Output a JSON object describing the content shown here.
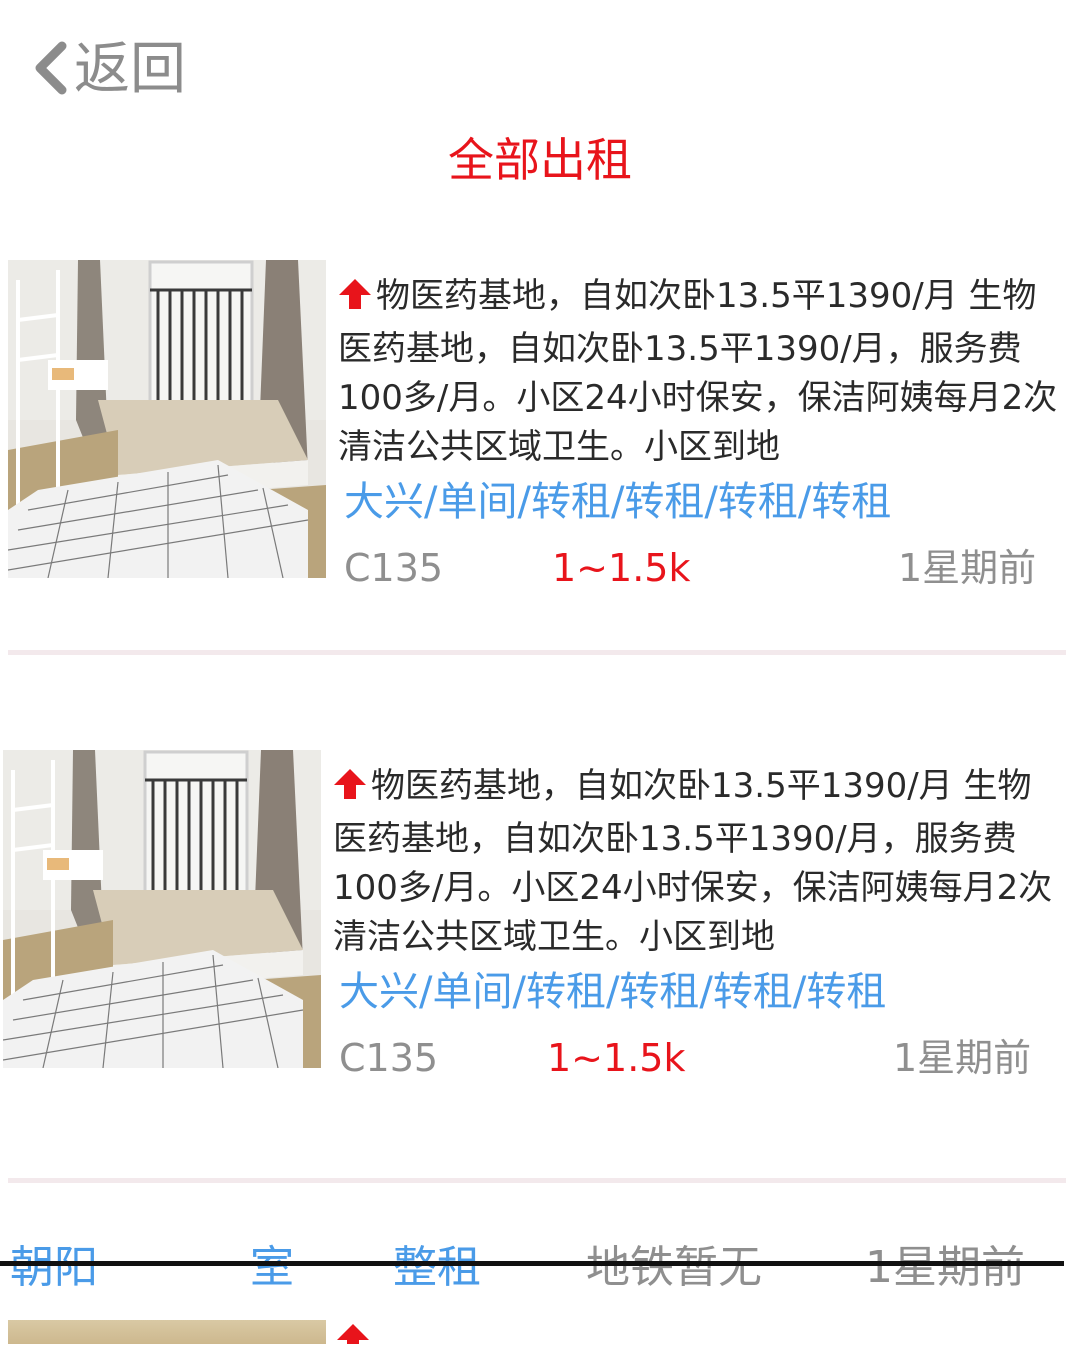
{
  "header": {
    "back_label": "返回"
  },
  "page_title": "全部出租",
  "listings": [
    {
      "description": "物医药基地，自如次卧13.5平1390/月 生物医药基地，自如次卧13.5平1390/月，服务费100多/月。小区24小时保安，保洁阿姨每月2次清洁公共区域卫生。小区到地",
      "tags": "大兴/单间/转租/转租/转租/转租",
      "code": "C135",
      "price": "1~1.5k",
      "time": "1星期前"
    },
    {
      "description": "物医药基地，自如次卧13.5平1390/月 生物医药基地，自如次卧13.5平1390/月，服务费100多/月。小区24小时保安，保洁阿姨每月2次清洁公共区域卫生。小区到地",
      "tags": "大兴/单间/转租/转租/转租/转租",
      "code": "C135",
      "price": "1~1.5k",
      "time": "1星期前"
    }
  ],
  "bottom_row": {
    "district": "朝阳",
    "room": "室",
    "rent_type": "整租",
    "subway": "地铁暂无",
    "time": "1星期前"
  },
  "colors": {
    "accent_red": "#e8141b",
    "tag_blue": "#4a9be8",
    "meta_gray": "#8f8f8f"
  }
}
